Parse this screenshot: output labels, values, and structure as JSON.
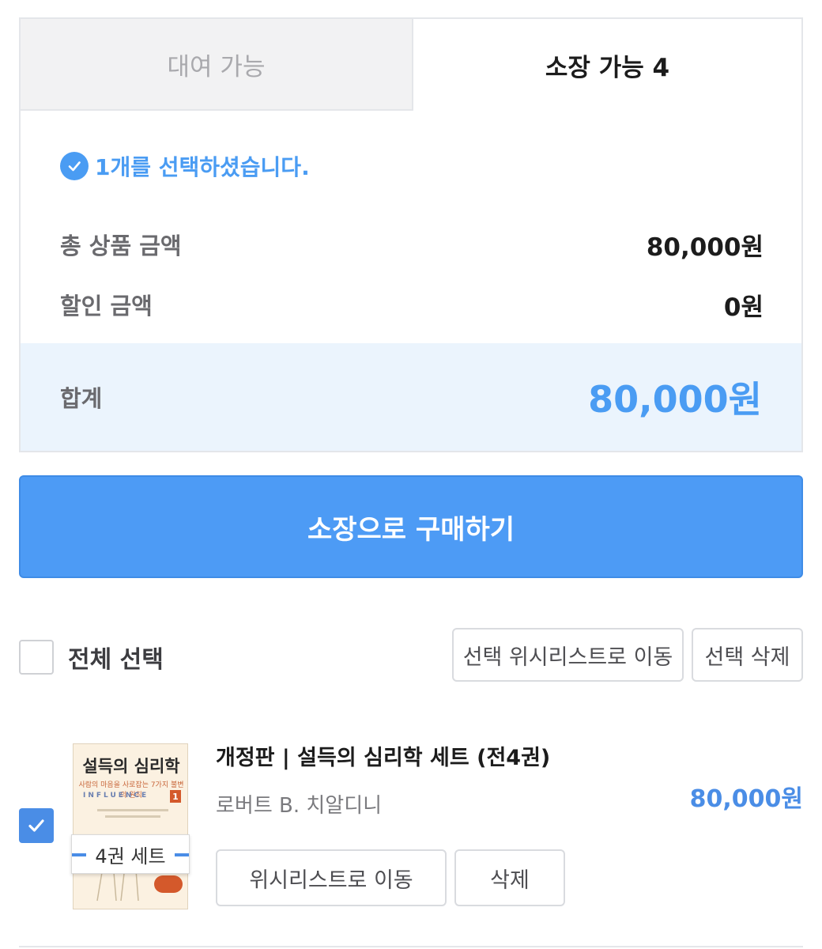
{
  "tabs": {
    "rent_label": "대여 가능",
    "own_label": "소장 가능 4"
  },
  "summary": {
    "selected_text": "1개를 선택하셨습니다.",
    "total_label": "총 상품 금액",
    "total_value": "80,000원",
    "discount_label": "할인 금액",
    "discount_value": "0원",
    "sum_label": "합계",
    "sum_value": "80,000원"
  },
  "buy_button_label": "소장으로 구매하기",
  "list_controls": {
    "select_all_label": "전체 선택",
    "move_selected_label": "선택 위시리스트로 이동",
    "delete_selected_label": "선택 삭제"
  },
  "item": {
    "checked": true,
    "cover_title": "설득의 심리학",
    "cover_subtitle": "사람의 마음을 사로잡는 7가지 불변의 원칙",
    "cover_series": "INFLUENCE",
    "cover_number": "1",
    "set_label": "4권 세트",
    "title": "개정판 | 설득의 심리학 세트 (전4권)",
    "author": "로버트 B. 치알디니",
    "price": "80,000원",
    "wishlist_label": "위시리스트로 이동",
    "delete_label": "삭제"
  },
  "colors": {
    "accent": "#4a9cf3",
    "button": "#4d9bf5",
    "sum_band": "#ebf4fd"
  }
}
